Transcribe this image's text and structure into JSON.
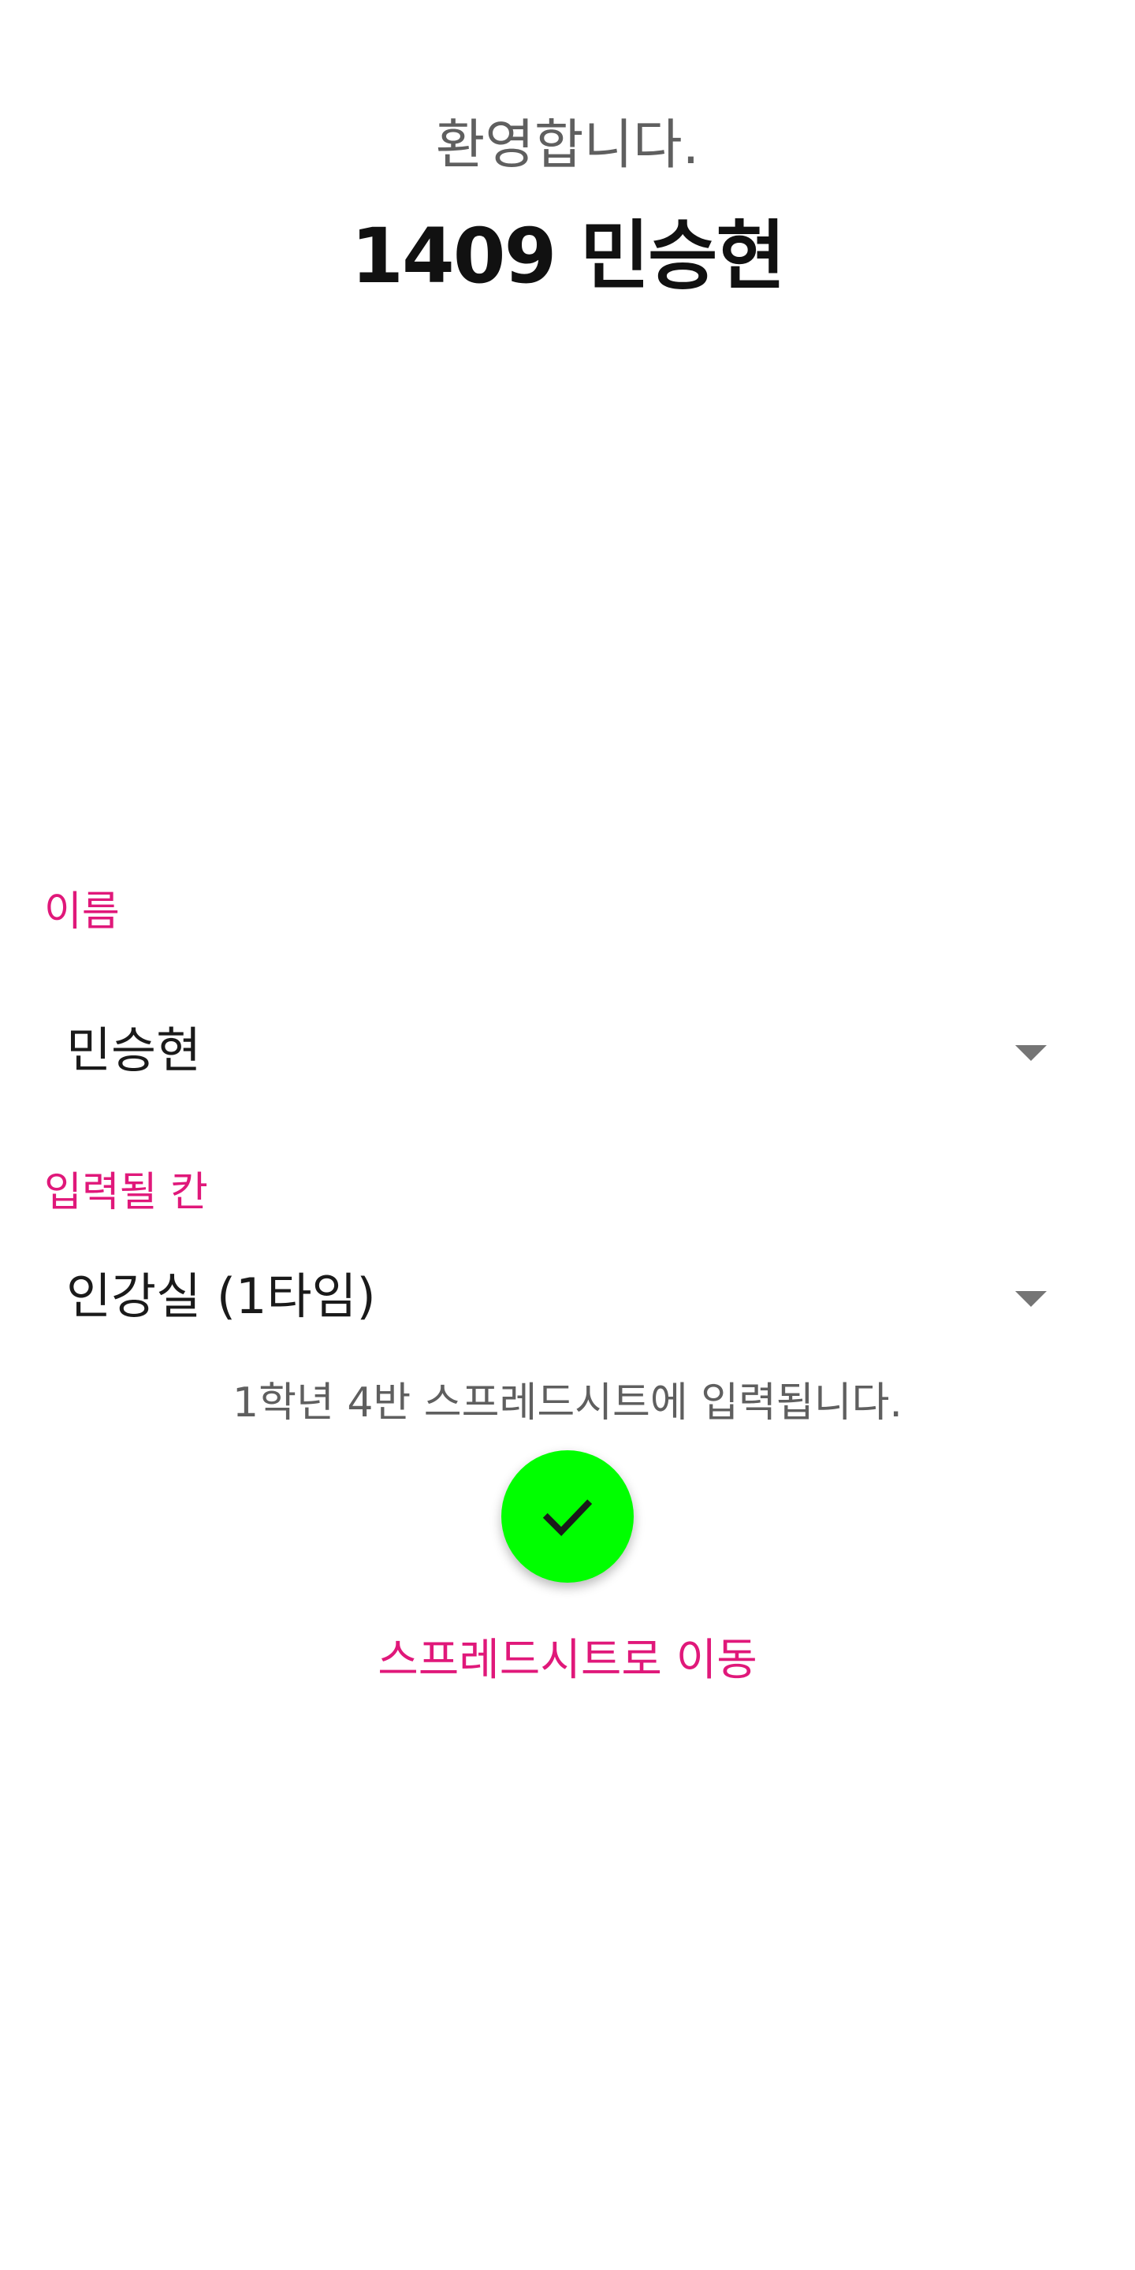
{
  "header": {
    "welcome": "환영합니다.",
    "user": "1409 민승현"
  },
  "form": {
    "name_label": "이름",
    "name_value": "민승현",
    "cell_label": "입력될 칸",
    "cell_value": "인강실 (1타임)"
  },
  "info": {
    "message": "1학년 4반 스프레드시트에 입력됩니다."
  },
  "actions": {
    "confirm_icon": "check-icon",
    "spreadsheet_link": "스프레드시트로 이동"
  },
  "colors": {
    "accent": "#e0187a",
    "confirm_button": "#00ff00",
    "secondary_text": "#5f5f5f"
  }
}
